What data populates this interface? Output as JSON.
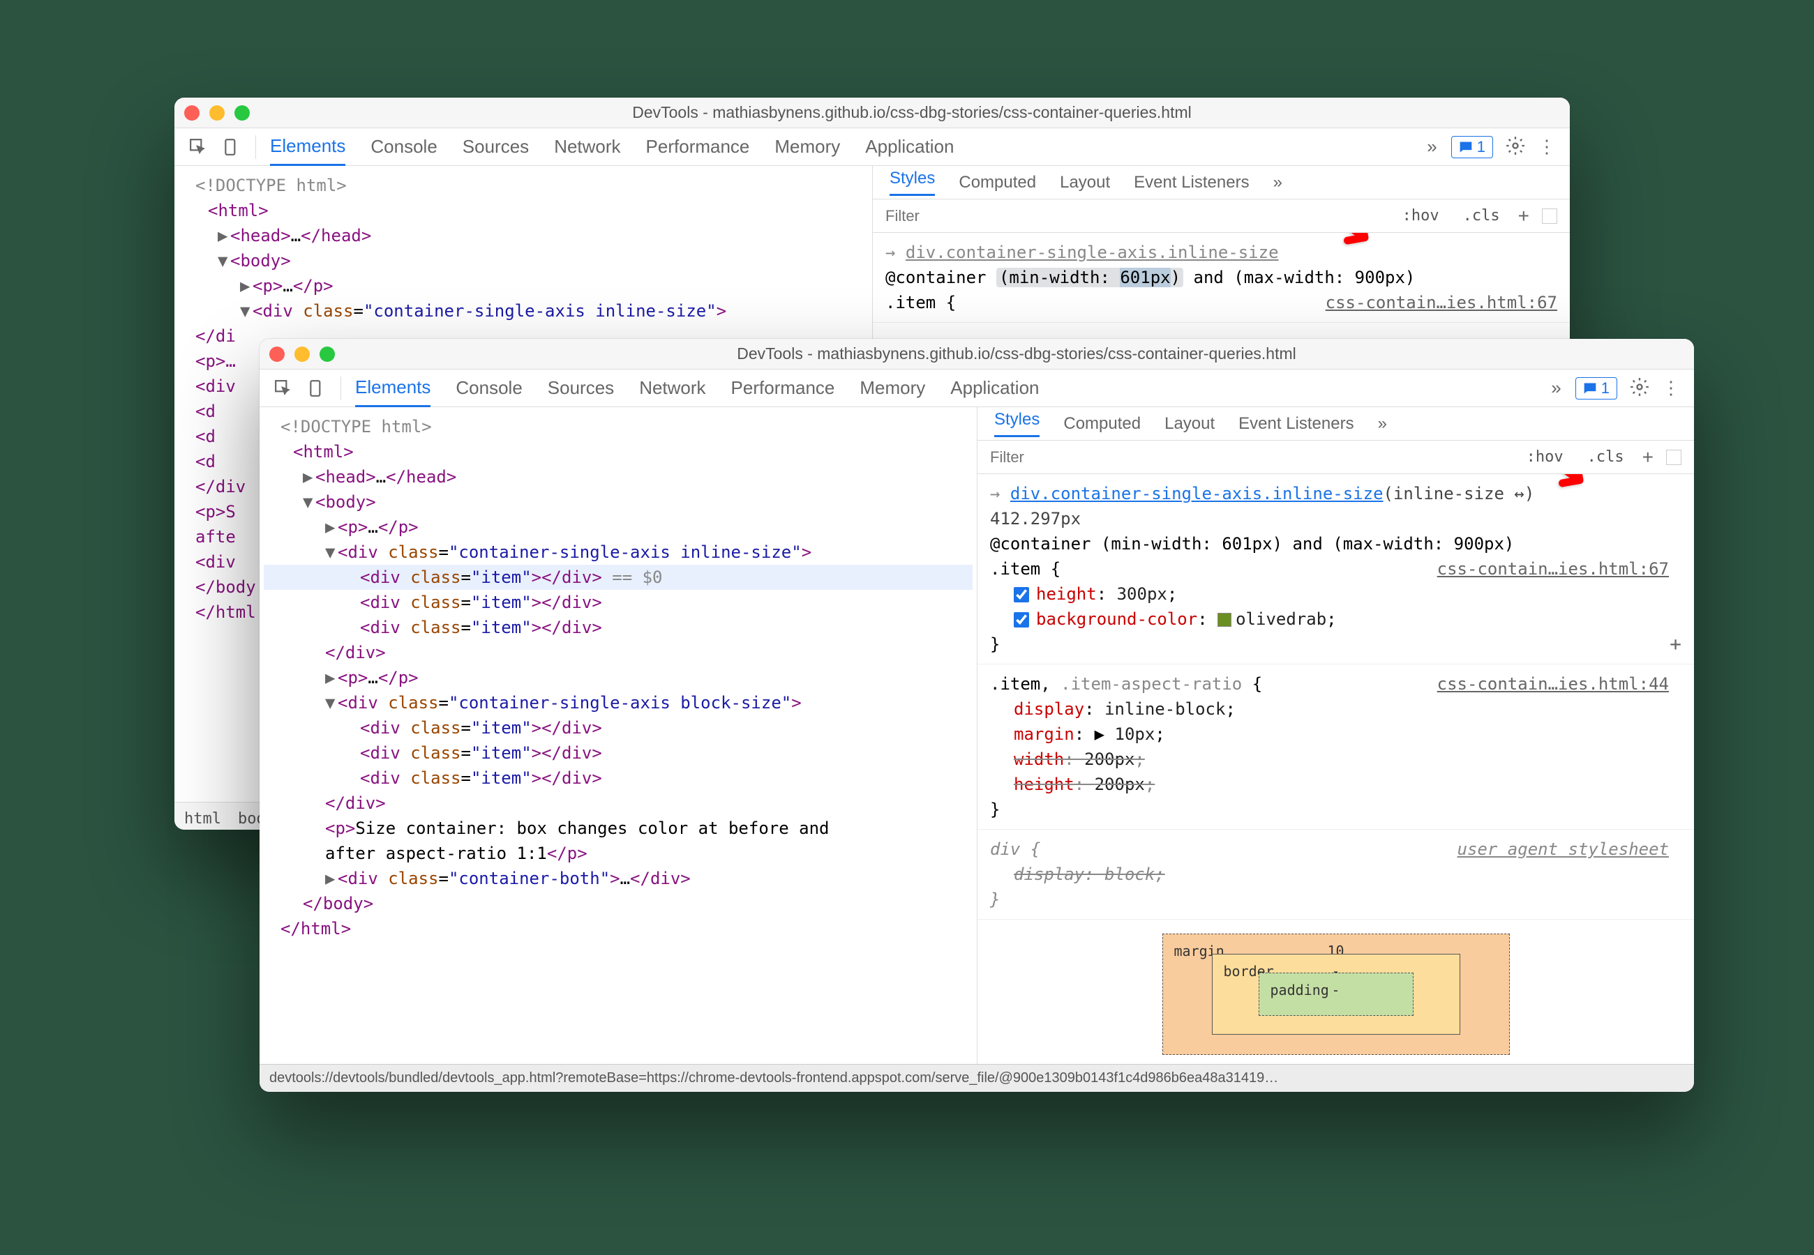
{
  "title": "DevTools - mathiasbynens.github.io/css-dbg-stories/css-container-queries.html",
  "mainTabs": [
    "Elements",
    "Console",
    "Sources",
    "Network",
    "Performance",
    "Memory",
    "Application"
  ],
  "activeTab": "Elements",
  "msgCount": "1",
  "subTabs": [
    "Styles",
    "Computed",
    "Layout",
    "Event Listeners"
  ],
  "activeSubTab": "Styles",
  "filterPlaceholder": "Filter",
  "hov": ":hov",
  "cls": ".cls",
  "back": {
    "domLines": [
      {
        "t": "cm",
        "txt": "<!DOCTYPE html>",
        "ind": 0
      },
      {
        "t": "open",
        "tag": "html",
        "ind": 0
      },
      {
        "t": "collapsed",
        "tag": "head",
        "ind": 1,
        "caret": "▶"
      },
      {
        "t": "open",
        "tag": "body",
        "ind": 1,
        "caret": "▼"
      },
      {
        "t": "collapsed",
        "tag": "p",
        "ind": 2,
        "caret": "▶"
      },
      {
        "t": "open",
        "tag": "div",
        "attrs": [
          [
            "class",
            "container-single-axis inline-size"
          ]
        ],
        "ind": 2,
        "caret": "▼"
      }
    ],
    "selPath": "div.container-single-axis.inline-size",
    "atRule": "@container (min-width: 601px) and (max-width: 900px)",
    "atHighlight": "601px",
    "selOpen": ".item {",
    "srcLink": "css-contain…ies.html:67",
    "partialDom": [
      "</di",
      "<p>…",
      "<div",
      "  <d",
      "  <d",
      "  <d",
      "</div",
      "<p>S",
      "afte",
      "<div",
      "</body",
      "</html"
    ],
    "crumbs": [
      "html",
      "bod"
    ]
  },
  "front": {
    "domLines": [
      {
        "t": "cm",
        "txt": "<!DOCTYPE html>",
        "ind": 0
      },
      {
        "t": "open",
        "tag": "html",
        "ind": 0
      },
      {
        "t": "collapsed",
        "tag": "head",
        "ind": 1,
        "caret": "▶"
      },
      {
        "t": "open",
        "tag": "body",
        "ind": 1,
        "caret": "▼"
      },
      {
        "t": "collapsed",
        "tag": "p",
        "ind": 2,
        "caret": "▶"
      },
      {
        "t": "open",
        "tag": "div",
        "attrs": [
          [
            "class",
            "container-single-axis inline-size"
          ]
        ],
        "ind": 2,
        "caret": "▼"
      },
      {
        "t": "selected",
        "tag": "div",
        "attrs": [
          [
            "class",
            "item"
          ]
        ],
        "ind": 3,
        "ghost": " == $0"
      },
      {
        "t": "pair",
        "tag": "div",
        "attrs": [
          [
            "class",
            "item"
          ]
        ],
        "ind": 3
      },
      {
        "t": "pair",
        "tag": "div",
        "attrs": [
          [
            "class",
            "item"
          ]
        ],
        "ind": 3
      },
      {
        "t": "close",
        "tag": "div",
        "ind": 2
      },
      {
        "t": "collapsed",
        "tag": "p",
        "ind": 2,
        "caret": "▶"
      },
      {
        "t": "open",
        "tag": "div",
        "attrs": [
          [
            "class",
            "container-single-axis block-size"
          ]
        ],
        "ind": 2,
        "caret": "▼"
      },
      {
        "t": "pair",
        "tag": "div",
        "attrs": [
          [
            "class",
            "item"
          ]
        ],
        "ind": 3
      },
      {
        "t": "pair",
        "tag": "div",
        "attrs": [
          [
            "class",
            "item"
          ]
        ],
        "ind": 3
      },
      {
        "t": "pair",
        "tag": "div",
        "attrs": [
          [
            "class",
            "item"
          ]
        ],
        "ind": 3
      },
      {
        "t": "close",
        "tag": "div",
        "ind": 2
      },
      {
        "t": "text",
        "txt": "Size container: box changes color at before and",
        "tag": "p",
        "ind": 2
      },
      {
        "t": "textcont",
        "txt": "after aspect-ratio 1:1",
        "ind": 2
      },
      {
        "t": "collapsed",
        "tag": "div",
        "attrs": [
          [
            "class",
            "container-both"
          ]
        ],
        "ind": 2,
        "caret": "▶"
      },
      {
        "t": "close",
        "tag": "body",
        "ind": 1
      },
      {
        "t": "close",
        "tag": "html",
        "ind": 0
      }
    ],
    "rules": {
      "selPath": "div.container-single-axis.inline-size",
      "dim": "(inline-size ↔)",
      "dimVal": "412.297px",
      "atRule": "@container (min-width: 601px) and (max-width: 900px)",
      "r1": {
        "sel": ".item {",
        "src": "css-contain…ies.html:67",
        "props": [
          {
            "n": "height",
            "v": "300px",
            "chk": true
          },
          {
            "n": "background-color",
            "v": "olivedrab",
            "chk": true,
            "swatch": true
          }
        ]
      },
      "r2": {
        "sel": ".item, .item-aspect-ratio {",
        "src": "css-contain…ies.html:44",
        "props": [
          {
            "n": "display",
            "v": "inline-block"
          },
          {
            "n": "margin",
            "v": "10px",
            "expand": true
          },
          {
            "n": "width",
            "v": "200px",
            "strike": true
          },
          {
            "n": "height",
            "v": "200px",
            "strike": true
          }
        ]
      },
      "r3": {
        "sel": "div {",
        "src": "user agent stylesheet",
        "ua": true,
        "props": [
          {
            "n": "display",
            "v": "block",
            "strike": true,
            "ua": true
          }
        ]
      }
    },
    "boxModel": {
      "margin": "margin",
      "marginVal": "10",
      "border": "border",
      "borderVal": "-",
      "padding": "padding",
      "paddingVal": "-"
    },
    "status": "devtools://devtools/bundled/devtools_app.html?remoteBase=https://chrome-devtools-frontend.appspot.com/serve_file/@900e1309b0143f1c4d986b6ea48a31419…"
  }
}
